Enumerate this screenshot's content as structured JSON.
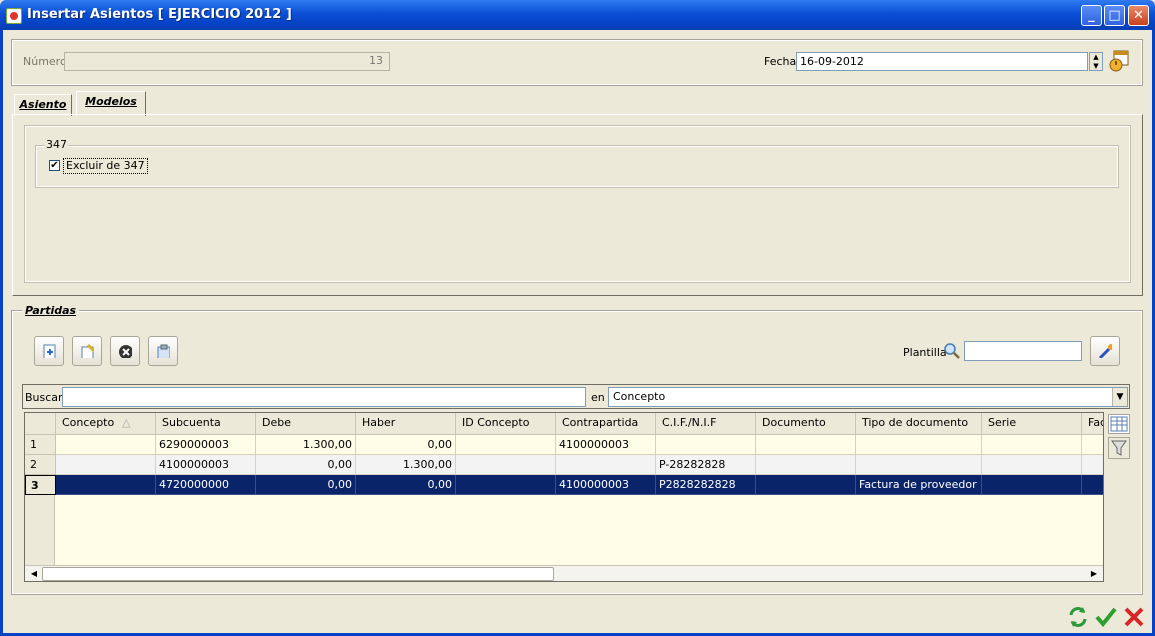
{
  "window": {
    "title": "Insertar Asientos [ EJERCICIO 2012 ]"
  },
  "header": {
    "numero_label": "Número",
    "numero_value": "13",
    "fecha_label": "Fecha",
    "fecha_value": "16-09-2012"
  },
  "tabs": [
    {
      "label": "Asiento",
      "active": false
    },
    {
      "label": "Modelos",
      "active": true
    }
  ],
  "modelos": {
    "group_label": "347",
    "checkbox_label": "Excluir de 347",
    "checkbox_checked": true
  },
  "partidas": {
    "title": "Partidas",
    "plantilla_label": "Plantilla",
    "plantilla_value": "",
    "buscar_label": "Buscar",
    "buscar_value": "",
    "en_label": "en",
    "en_value": "Concepto",
    "columns": [
      "Concepto",
      "Subcuenta",
      "Debe",
      "Haber",
      "ID Concepto",
      "Contrapartida",
      "C.I.F./N.I.F",
      "Documento",
      "Tipo de documento",
      "Serie",
      "Fac"
    ],
    "rows": [
      {
        "n": "1",
        "concepto": "",
        "subcuenta": "6290000003",
        "debe": "1.300,00",
        "haber": "0,00",
        "id_concepto": "",
        "contrapartida": "4100000003",
        "cif": "",
        "documento": "",
        "tipo": "",
        "serie": "",
        "fac": ""
      },
      {
        "n": "2",
        "concepto": "",
        "subcuenta": "4100000003",
        "debe": "0,00",
        "haber": "1.300,00",
        "id_concepto": "",
        "contrapartida": "",
        "cif": "P-28282828",
        "documento": "",
        "tipo": "",
        "serie": "",
        "fac": ""
      },
      {
        "n": "3",
        "concepto": "",
        "subcuenta": "4720000000",
        "debe": "0,00",
        "haber": "0,00",
        "id_concepto": "",
        "contrapartida": "4100000003",
        "cif": "P2828282828",
        "documento": "",
        "tipo": "Factura de proveedor",
        "serie": "",
        "fac": ""
      }
    ],
    "selected_row": 3
  },
  "icons": {
    "toolbar": [
      "new-row-icon",
      "edit-row-icon",
      "delete-row-icon",
      "paste-icon"
    ],
    "wand": "magic-wand-icon",
    "grid_side": [
      "grid-columns-icon",
      "filter-icon"
    ],
    "footer": [
      "refresh-icon",
      "accept-icon",
      "cancel-icon"
    ]
  },
  "colors": {
    "titlebar": "#0a4fd6",
    "selection": "#0a246a",
    "accept": "#2ca02c",
    "cancel": "#d62728"
  }
}
